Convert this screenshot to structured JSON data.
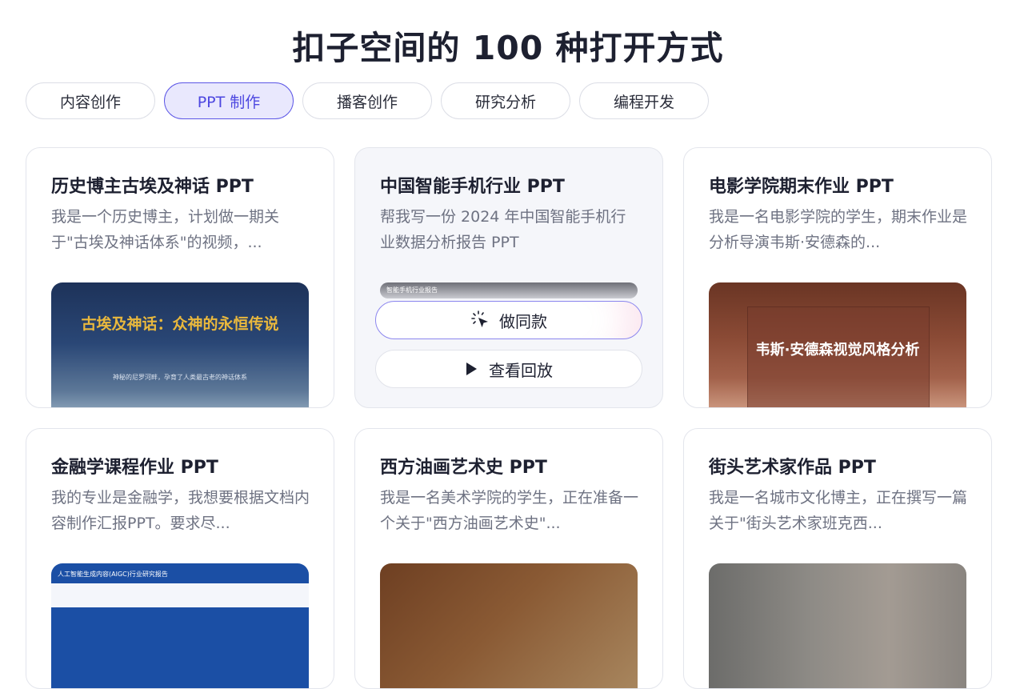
{
  "page_title": "扣子空间的 100 种打开方式",
  "tabs": [
    {
      "label": "内容创作",
      "active": false
    },
    {
      "label": "PPT 制作",
      "active": true
    },
    {
      "label": "播客创作",
      "active": false
    },
    {
      "label": "研究分析",
      "active": false
    },
    {
      "label": "编程开发",
      "active": false
    }
  ],
  "cards": [
    {
      "title": "历史博主古埃及神话 PPT",
      "desc": "我是一个历史博主，计划做一期关于\"古埃及神话体系\"的视频，...",
      "thumb": {
        "heading": "古埃及神话：众神的永恒传说",
        "subtitle": "神秘的尼罗河畔，孕育了人类最古老的神话体系"
      }
    },
    {
      "title": "中国智能手机行业 PPT",
      "desc": "帮我写一份 2024 年中国智能手机行业数据分析报告 PPT",
      "thumb": {
        "heading": "智能手机行业报告"
      },
      "actions": {
        "same": "做同款",
        "replay": "查看回放"
      }
    },
    {
      "title": "电影学院期末作业 PPT",
      "desc": "我是一名电影学院的学生，期末作业是分析导演韦斯·安德森的...",
      "thumb": {
        "heading": "韦斯·安德森视觉风格分析"
      }
    },
    {
      "title": "金融学课程作业 PPT",
      "desc": "我的专业是金融学，我想要根据文档内容制作汇报PPT。要求尽...",
      "thumb": {
        "heading": "人工智能生成内容(AIGC)行业研究报告"
      }
    },
    {
      "title": "西方油画艺术史 PPT",
      "desc": "我是一名美术学院的学生，正在准备一个关于\"西方油画艺术史\"...",
      "thumb": {}
    },
    {
      "title": "街头艺术家作品 PPT",
      "desc": "我是一名城市文化博主，正在撰写一篇关于\"街头艺术家班克西...",
      "thumb": {}
    }
  ],
  "colors": {
    "accent": "#5c56e6",
    "tab_active_bg": "#e9e8fd"
  },
  "icons": {
    "same": "sparkle-cursor-icon",
    "replay": "play-icon"
  }
}
